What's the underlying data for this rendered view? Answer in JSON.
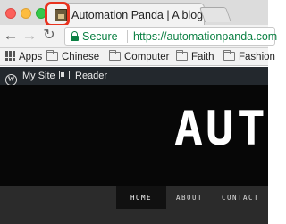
{
  "browser": {
    "tab": {
      "title": "Automation Panda | A blog for",
      "favicon": "automation-panda-favicon"
    },
    "address_bar": {
      "security_label": "Secure",
      "url": "https://automationpanda.com"
    },
    "bookmarks": [
      {
        "label": "Apps",
        "icon": "apps-grid-icon"
      },
      {
        "label": "Chinese",
        "icon": "folder-icon"
      },
      {
        "label": "Computer",
        "icon": "folder-icon"
      },
      {
        "label": "Faith",
        "icon": "folder-icon"
      },
      {
        "label": "Fashion",
        "icon": "folder-icon"
      }
    ],
    "colors": {
      "secure_green": "#0b8043",
      "highlight_red": "#e8321e"
    }
  },
  "admin_bar": {
    "my_site": "My Site",
    "reader": "Reader"
  },
  "site": {
    "title": "AUTO",
    "nav": {
      "home": "HOME",
      "about": "ABOUT",
      "contact": "CONTACT"
    }
  }
}
